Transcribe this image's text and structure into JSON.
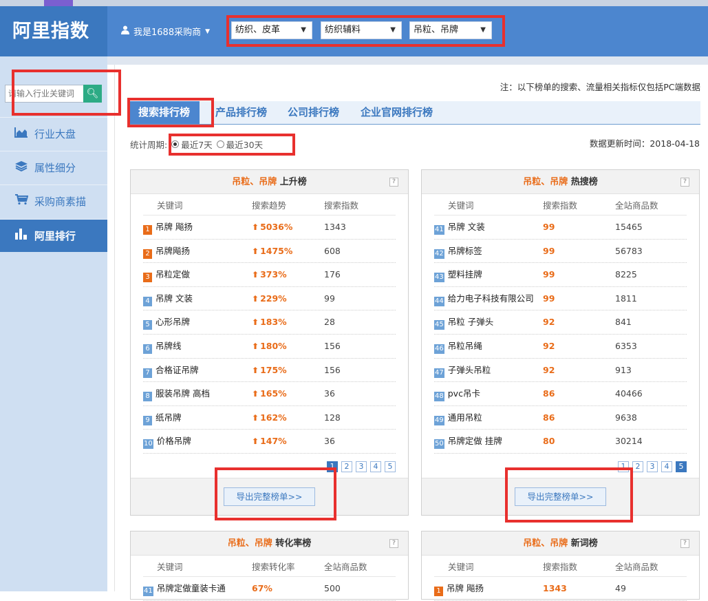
{
  "app": {
    "brand": "阿里指数"
  },
  "header": {
    "user": "我是1688采购商",
    "selects": [
      "纺织、皮革",
      "纺织辅料",
      "吊粒、吊牌"
    ]
  },
  "sidebar": {
    "search_placeholder": "请输入行业关键词",
    "items": [
      {
        "label": "行业大盘",
        "icon": "chart-area-icon"
      },
      {
        "label": "属性细分",
        "icon": "layers-icon"
      },
      {
        "label": "采购商素描",
        "icon": "cart-icon"
      },
      {
        "label": "阿里排行",
        "icon": "bar-chart-icon",
        "active": true
      }
    ]
  },
  "main": {
    "note": "注：以下榜单的搜索、流量相关指标仅包括PC端数据",
    "tabs": [
      "搜索排行榜",
      "产品排行榜",
      "公司排行榜",
      "企业官网排行榜"
    ],
    "period_label": "统计周期:",
    "period_options": [
      "最近7天",
      "最近30天"
    ],
    "updated": "数据更新时间：2018-04-18",
    "export_label": "导出完整榜单>>",
    "panels": [
      {
        "category": "吊粒、吊牌",
        "title": "上升榜",
        "columns": [
          "关键词",
          "搜索趋势",
          "搜索指数"
        ],
        "rows": [
          {
            "rank": "1",
            "kw": "吊牌 飚扬",
            "v2": "5036%",
            "v3": "1343"
          },
          {
            "rank": "2",
            "kw": "吊牌飚扬",
            "v2": "1475%",
            "v3": "608"
          },
          {
            "rank": "3",
            "kw": "吊粒定做",
            "v2": "373%",
            "v3": "176"
          },
          {
            "rank": "4",
            "kw": "吊牌 文装",
            "v2": "229%",
            "v3": "99"
          },
          {
            "rank": "5",
            "kw": "心形吊牌",
            "v2": "183%",
            "v3": "28"
          },
          {
            "rank": "6",
            "kw": "吊牌线",
            "v2": "180%",
            "v3": "156"
          },
          {
            "rank": "7",
            "kw": "合格证吊牌",
            "v2": "175%",
            "v3": "156"
          },
          {
            "rank": "8",
            "kw": "服装吊牌 高档",
            "v2": "165%",
            "v3": "36"
          },
          {
            "rank": "9",
            "kw": "纸吊牌",
            "v2": "162%",
            "v3": "128"
          },
          {
            "rank": "10",
            "kw": "价格吊牌",
            "v2": "147%",
            "v3": "36"
          }
        ],
        "pages": [
          "1",
          "2",
          "3",
          "4",
          "5"
        ],
        "current_page": "1"
      },
      {
        "category": "吊粒、吊牌",
        "title": "热搜榜",
        "columns": [
          "关键词",
          "搜索指数",
          "全站商品数"
        ],
        "rows": [
          {
            "rank": "41",
            "kw": "吊牌 文装",
            "v2": "99",
            "v3": "15465"
          },
          {
            "rank": "42",
            "kw": "吊牌标签",
            "v2": "99",
            "v3": "56783"
          },
          {
            "rank": "43",
            "kw": "塑料挂牌",
            "v2": "99",
            "v3": "8225"
          },
          {
            "rank": "44",
            "kw": "给力电子科技有限公司",
            "v2": "99",
            "v3": "1811"
          },
          {
            "rank": "45",
            "kw": "吊粒 子弹头",
            "v2": "92",
            "v3": "841"
          },
          {
            "rank": "46",
            "kw": "吊粒吊绳",
            "v2": "92",
            "v3": "6353"
          },
          {
            "rank": "47",
            "kw": "子弹头吊粒",
            "v2": "92",
            "v3": "913"
          },
          {
            "rank": "48",
            "kw": "pvc吊卡",
            "v2": "86",
            "v3": "40466"
          },
          {
            "rank": "49",
            "kw": "通用吊粒",
            "v2": "86",
            "v3": "9638"
          },
          {
            "rank": "50",
            "kw": "吊牌定做 挂牌",
            "v2": "80",
            "v3": "30214"
          }
        ],
        "pages": [
          "1",
          "2",
          "3",
          "4",
          "5"
        ],
        "current_page": "5"
      },
      {
        "category": "吊粒、吊牌",
        "title": "转化率榜",
        "columns": [
          "关键词",
          "搜索转化率",
          "全站商品数"
        ],
        "rows": [
          {
            "rank": "41",
            "kw": "吊牌定做童装卡通",
            "v2": "67%",
            "v3": "500"
          }
        ]
      },
      {
        "category": "吊粒、吊牌",
        "title": "新词榜",
        "columns": [
          "关键词",
          "搜索指数",
          "全站商品数"
        ],
        "rows": [
          {
            "rank": "1",
            "kw": "吊牌 飚扬",
            "v2": "1343",
            "v3": "49"
          }
        ]
      }
    ]
  },
  "colors": {
    "brand": "#3b78bf",
    "header": "#4c86cf",
    "accent": "#e96c19",
    "highlight": "#e8302e"
  }
}
